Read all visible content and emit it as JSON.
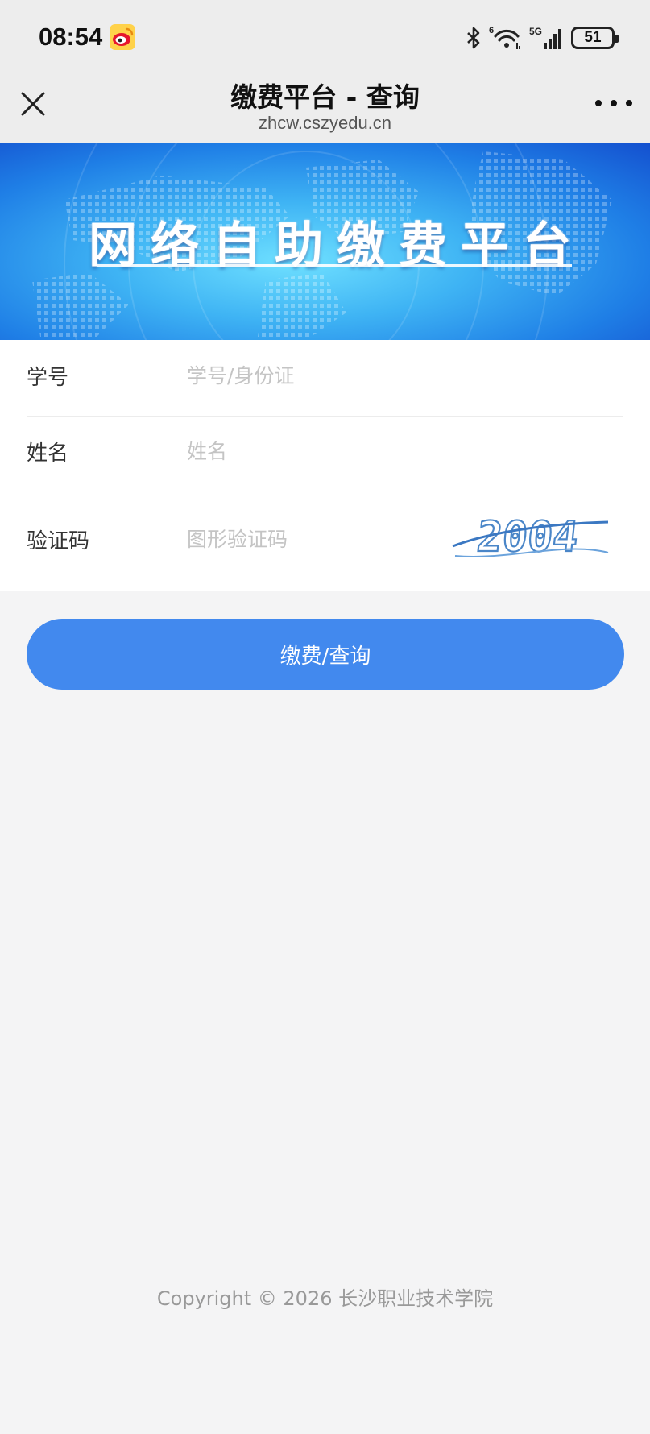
{
  "status_bar": {
    "time": "08:54",
    "app_icon": "weibo-icon",
    "icons": [
      "bluetooth-icon",
      "wifi-icon",
      "signal-5g-icon"
    ],
    "wifi_badge": "6",
    "network": "5G",
    "battery": "51"
  },
  "nav": {
    "title": "缴费平台 - 查询",
    "url": "zhcw.cszyedu.cn",
    "close_icon": "close-icon",
    "more_icon": "more-icon"
  },
  "banner": {
    "title": "网络自助缴费平台"
  },
  "form": {
    "student_id": {
      "label": "学号",
      "placeholder": "学号/身份证",
      "value": ""
    },
    "name": {
      "label": "姓名",
      "placeholder": "姓名",
      "value": ""
    },
    "captcha": {
      "label": "验证码",
      "placeholder": "图形验证码",
      "value": "",
      "image_text": "2004"
    }
  },
  "submit_label": "缴费/查询",
  "footer": {
    "copyright": "Copyright © 2026  长沙职业技术学院"
  },
  "colors": {
    "primary": "#4289ee",
    "background": "#f4f4f5",
    "header": "#ededed",
    "placeholder": "#c4c4c4"
  }
}
